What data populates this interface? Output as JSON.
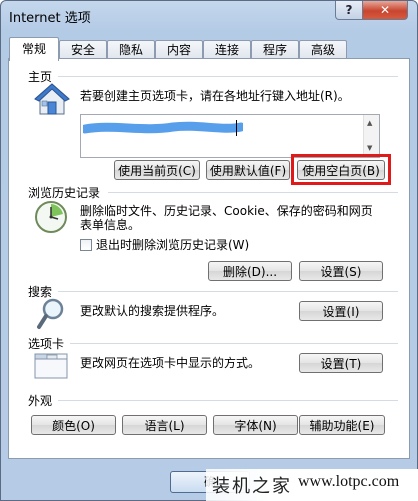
{
  "window": {
    "title": "Internet 选项",
    "help_label": "?",
    "close_label": "✕"
  },
  "tabs": [
    {
      "label": "常规",
      "active": true
    },
    {
      "label": "安全"
    },
    {
      "label": "隐私"
    },
    {
      "label": "内容"
    },
    {
      "label": "连接"
    },
    {
      "label": "程序"
    },
    {
      "label": "高级"
    }
  ],
  "homepage": {
    "group": "主页",
    "description": "若要创建主页选项卡，请在各地址行键入地址(R)。",
    "buttons": {
      "use_current": "使用当前页(C)",
      "use_default": "使用默认值(F)",
      "use_blank": "使用空白页(B)"
    }
  },
  "history": {
    "group": "浏览历史记录",
    "description_line1": "删除临时文件、历史记录、Cookie、保存的密码和网页",
    "description_line2": "表单信息。",
    "checkbox": "退出时删除浏览历史记录(W)",
    "delete_button": "删除(D)...",
    "settings_button": "设置(S)"
  },
  "search": {
    "group": "搜索",
    "description": "更改默认的搜索提供程序。",
    "settings_button": "设置(I)"
  },
  "tabs_section": {
    "group": "选项卡",
    "description": "更改网页在选项卡中显示的方式。",
    "settings_button": "设置(T)"
  },
  "appearance": {
    "group": "外观",
    "buttons": {
      "colors": "颜色(O)",
      "languages": "语言(L)",
      "fonts": "字体(N)",
      "accessibility": "辅助功能(E)"
    }
  },
  "footer": {
    "ok_partial": "确"
  },
  "watermark": {
    "text": "装机之家",
    "url": "www.lotpc.com"
  }
}
